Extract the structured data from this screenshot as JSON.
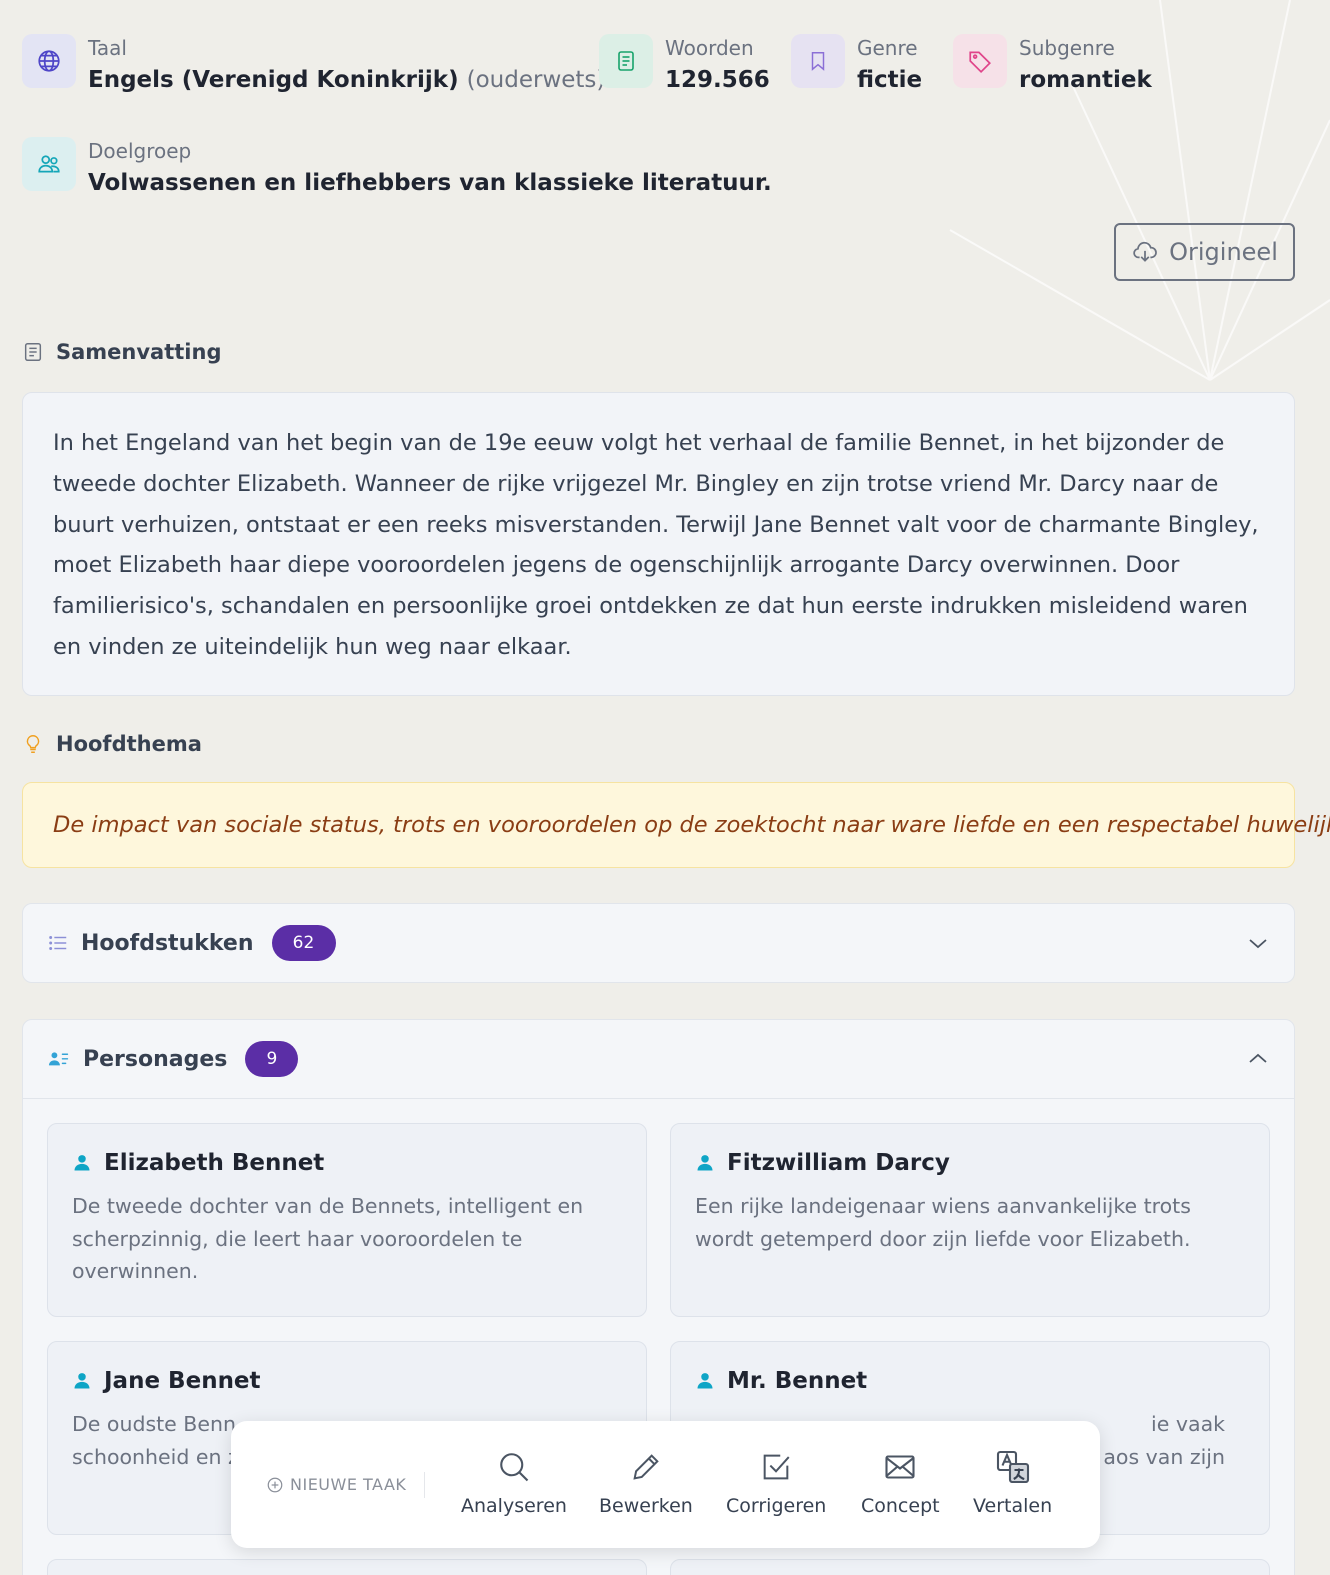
{
  "meta": {
    "language_label": "Taal",
    "language_value": "Engels (Verenigd Koninkrijk)",
    "language_note": "(ouderwets)",
    "words_label": "Woorden",
    "words_value": "129.566",
    "genre_label": "Genre",
    "genre_value": "fictie",
    "subgenre_label": "Subgenre",
    "subgenre_value": "romantiek",
    "audience_label": "Doelgroep",
    "audience_value": "Volwassenen en liefhebbers van klassieke literatuur."
  },
  "original_button": "Origineel",
  "summary": {
    "title": "Samenvatting",
    "text": "In het Engeland van het begin van de 19e eeuw volgt het verhaal de familie Bennet, in het bijzonder de tweede dochter Elizabeth. Wanneer de rijke vrijgezel Mr. Bingley en zijn trotse vriend Mr. Darcy naar de buurt verhuizen, ontstaat er een reeks misverstanden. Terwijl Jane Bennet valt voor de charmante Bingley, moet Elizabeth haar diepe vooroordelen jegens de ogenschijnlijk arrogante Darcy overwinnen. Door familierisico's, schandalen en persoonlijke groei ontdekken ze dat hun eerste indrukken misleidend waren en vinden ze uiteindelijk hun weg naar elkaar."
  },
  "theme": {
    "title": "Hoofdthema",
    "text": "De impact van sociale status, trots en vooroordelen op de zoektocht naar ware liefde en een respectabel huwelijk."
  },
  "chapters": {
    "title": "Hoofdstukken",
    "count": "62"
  },
  "characters": {
    "title": "Personages",
    "count": "9",
    "items": [
      {
        "name": "Elizabeth Bennet",
        "desc": "De tweede dochter van de Bennets, intelligent en scherpzinnig, die leert haar vooroordelen te overwinnen."
      },
      {
        "name": "Fitzwilliam Darcy",
        "desc": "Een rijke landeigenaar wiens aanvankelijke trots wordt getemperd door zijn liefde voor Elizabeth."
      },
      {
        "name": "Jane Bennet",
        "desc_visible_start": "De oudste Benn",
        "desc_visible_line2": "schoonheid en z"
      },
      {
        "name": "Mr. Bennet",
        "desc_visible_end": "ie vaak",
        "desc_visible_line2_end": "aos van zijn"
      }
    ]
  },
  "toolbar": {
    "new_task": "NIEUWE TAAK",
    "tools": [
      "Analyseren",
      "Bewerken",
      "Corrigeren",
      "Concept",
      "Vertalen"
    ]
  },
  "colors": {
    "accent_purple": "#5b2ea6",
    "theme_text": "#8a3d14",
    "theme_bg": "#fef7dc",
    "person_icon": "#0ea5c6"
  }
}
